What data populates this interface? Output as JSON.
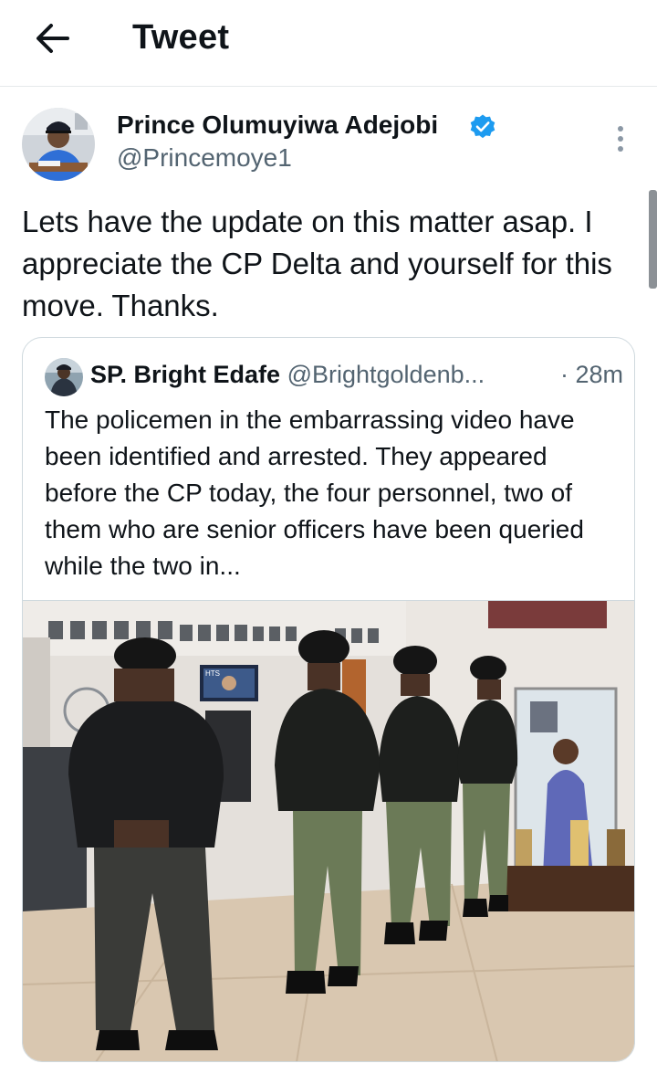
{
  "header": {
    "title": "Tweet",
    "back_icon": "arrow-left-icon"
  },
  "tweet": {
    "author_name": "Prince Olumuyiwa Adejobi",
    "author_handle": "@Princemoye1",
    "verified_icon": "verified-badge-icon",
    "more_icon": "more-vertical-icon",
    "text": "Lets have the update on this matter asap. I appreciate the CP Delta and yourself for this move. Thanks."
  },
  "quoted": {
    "author_name": "SP. Bright Edafe",
    "author_handle": "@Brightgoldenb...",
    "time": "· 28m",
    "text": "The policemen in the embarrassing video have been identified and arrested. They appeared before the CP today, the four personnel,  two of them who are senior officers have been queried while the two in...",
    "tv_caption": "HTS"
  },
  "colors": {
    "verified_blue": "#1d9bf0",
    "secondary_text": "#536471",
    "border": "#cfd9de"
  }
}
